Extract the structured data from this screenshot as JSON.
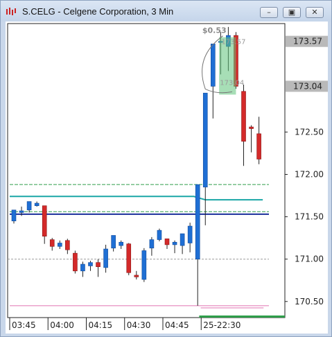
{
  "window": {
    "title": "S.CELG - Celgene Corporation, 3 Min",
    "minimize_glyph": "–",
    "restore_glyph": "▣",
    "close_glyph": "✕"
  },
  "chart_data": {
    "type": "candlestick",
    "symbol": "S.CELG",
    "interval": "3 Min",
    "y_tick_labels": [
      "172.50",
      "172.00",
      "171.50",
      "171.00",
      "170.50"
    ],
    "y_ticks": [
      172.5,
      172.0,
      171.5,
      171.0,
      170.5
    ],
    "ylim": [
      170.31,
      173.78
    ],
    "price_tags": [
      {
        "label": "173.57",
        "value": 173.57
      },
      {
        "label": "173.04",
        "value": 173.04
      }
    ],
    "x_tick_labels": [
      "03:45",
      "04:00",
      "04:15",
      "04:30",
      "04:45",
      "25-22:30"
    ],
    "x_tick_bar_index": [
      0,
      5,
      10,
      15,
      20,
      25
    ],
    "candles": [
      {
        "o": 171.45,
        "h": 171.58,
        "l": 171.42,
        "c": 171.58
      },
      {
        "o": 171.55,
        "h": 171.62,
        "l": 171.51,
        "c": 171.57
      },
      {
        "o": 171.58,
        "h": 171.68,
        "l": 171.55,
        "c": 171.68
      },
      {
        "o": 171.63,
        "h": 171.68,
        "l": 171.62,
        "c": 171.66
      },
      {
        "o": 171.63,
        "h": 171.63,
        "l": 171.18,
        "c": 171.27
      },
      {
        "o": 171.23,
        "h": 171.25,
        "l": 171.1,
        "c": 171.15
      },
      {
        "o": 171.15,
        "h": 171.22,
        "l": 171.12,
        "c": 171.19
      },
      {
        "o": 171.22,
        "h": 171.24,
        "l": 171.06,
        "c": 171.11
      },
      {
        "o": 171.07,
        "h": 171.1,
        "l": 170.83,
        "c": 170.86
      },
      {
        "o": 170.86,
        "h": 170.97,
        "l": 170.79,
        "c": 170.94
      },
      {
        "o": 170.92,
        "h": 170.98,
        "l": 170.86,
        "c": 170.96
      },
      {
        "o": 170.96,
        "h": 171.0,
        "l": 170.79,
        "c": 170.91
      },
      {
        "o": 170.9,
        "h": 171.17,
        "l": 170.84,
        "c": 171.12
      },
      {
        "o": 171.13,
        "h": 171.28,
        "l": 171.09,
        "c": 171.28
      },
      {
        "o": 171.16,
        "h": 171.22,
        "l": 171.12,
        "c": 171.2
      },
      {
        "o": 171.18,
        "h": 171.19,
        "l": 170.81,
        "c": 170.84
      },
      {
        "o": 170.81,
        "h": 170.86,
        "l": 170.76,
        "c": 170.79
      },
      {
        "o": 170.76,
        "h": 171.13,
        "l": 170.73,
        "c": 171.1
      },
      {
        "o": 171.13,
        "h": 171.26,
        "l": 171.04,
        "c": 171.23
      },
      {
        "o": 171.23,
        "h": 171.36,
        "l": 171.21,
        "c": 171.34
      },
      {
        "o": 171.24,
        "h": 171.24,
        "l": 171.12,
        "c": 171.17
      },
      {
        "o": 171.17,
        "h": 171.22,
        "l": 171.07,
        "c": 171.2
      },
      {
        "o": 171.16,
        "h": 171.3,
        "l": 171.06,
        "c": 171.3
      },
      {
        "o": 171.19,
        "h": 171.43,
        "l": 171.08,
        "c": 171.39
      },
      {
        "o": 171.0,
        "h": 171.88,
        "l": 170.45,
        "c": 171.88
      },
      {
        "o": 171.85,
        "h": 172.96,
        "l": 171.4,
        "c": 172.96
      },
      {
        "o": 173.04,
        "h": 173.54,
        "l": 172.66,
        "c": 173.54
      },
      {
        "o": 173.57,
        "h": 173.68,
        "l": 173.18,
        "c": 173.57
      },
      {
        "o": 173.51,
        "h": 173.74,
        "l": 173.22,
        "c": 173.64
      },
      {
        "o": 173.64,
        "h": 173.68,
        "l": 173.01,
        "c": 173.04
      },
      {
        "o": 172.98,
        "h": 173.06,
        "l": 172.1,
        "c": 172.39
      },
      {
        "o": 172.56,
        "h": 172.58,
        "l": 172.26,
        "c": 172.54
      },
      {
        "o": 172.48,
        "h": 172.68,
        "l": 172.12,
        "c": 172.18
      }
    ],
    "horizontal_lines": [
      {
        "value": 171.88,
        "color": "#2e9e4a",
        "style": "dashed"
      },
      {
        "value": 171.53,
        "color": "#1a2e9a",
        "style": "solid"
      },
      {
        "value": 171.56,
        "color": "#2e9e4a",
        "style": "dashed"
      },
      {
        "value": 171.0,
        "color": "#9a9a9a",
        "style": "dashed"
      },
      {
        "value": 170.45,
        "color": "#e070b0",
        "style": "solid"
      }
    ],
    "teal_line": [
      {
        "bar": 0,
        "value": 171.74
      },
      {
        "bar": 23.5,
        "value": 171.74
      },
      {
        "bar": 25,
        "value": 171.7
      },
      {
        "bar": 32.5,
        "value": 171.7
      }
    ],
    "annotation": {
      "price_label": "$0.53",
      "upper_label": "173.57",
      "lower_label": "173.04"
    },
    "colors": {
      "bull": "#1f6fd4",
      "bear": "#d42a2a",
      "wick": "#222222",
      "highlight": "#5ec37a"
    }
  }
}
